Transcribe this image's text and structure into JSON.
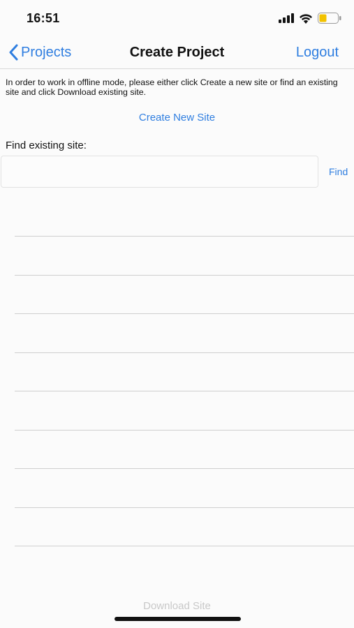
{
  "status_bar": {
    "time": "16:51",
    "signal_icon": "cellular-signal-icon",
    "wifi_icon": "wifi-icon",
    "battery_icon": "battery-low-icon",
    "battery_color": "#f2c200"
  },
  "nav": {
    "back_label": "Projects",
    "title": "Create Project",
    "logout_label": "Logout",
    "accent_color": "#2f7ee0"
  },
  "instructions": "In order to work in offline mode, please either click Create a new site or find an existing site and click Download existing site.",
  "create_site_label": "Create New Site",
  "find": {
    "label": "Find existing site:",
    "input_value": "",
    "button_label": "Find"
  },
  "results": {
    "rows": [
      "",
      "",
      "",
      "",
      "",
      "",
      "",
      "",
      ""
    ]
  },
  "download_label": "Download Site"
}
